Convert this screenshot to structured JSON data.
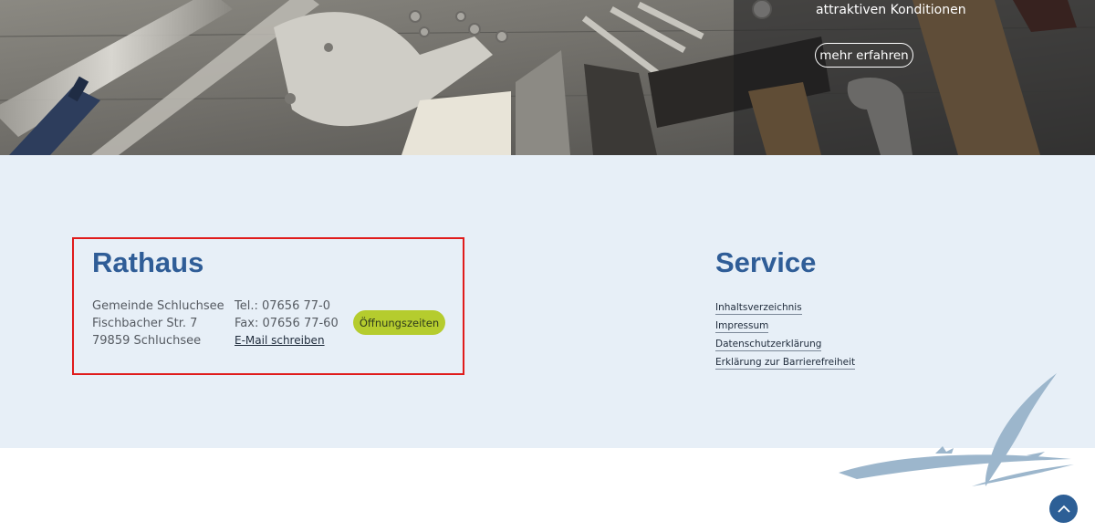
{
  "hero": {
    "text": "attraktiven Konditionen",
    "button_label": "mehr erfahren"
  },
  "rathaus": {
    "title": "Rathaus",
    "address": [
      "Gemeinde Schluchsee",
      "Fischbacher Str. 7",
      "79859 Schluchsee"
    ],
    "phone": "Tel.: 07656 77-0",
    "fax": "Fax: 07656 77-60",
    "email_label": "E-Mail schreiben",
    "hours_button": "Öffnungszeiten"
  },
  "service": {
    "title": "Service",
    "links": [
      "Inhaltsverzeichnis",
      "Impressum",
      "Datenschutzerklärung",
      "Erklärung zur Barrierefreiheit"
    ]
  },
  "colors": {
    "title_blue": "#2f5d97",
    "footer_bg": "#e7eff7",
    "accent_green": "#b5cc2e",
    "highlight_red": "#e01b1b"
  },
  "icons": {
    "scroll_top": "chevron-up-icon",
    "logo": "sailboat-logo"
  }
}
